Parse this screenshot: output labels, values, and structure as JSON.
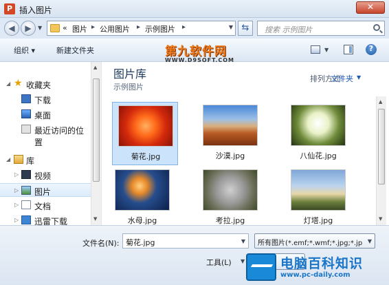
{
  "window": {
    "title": "插入图片",
    "app_icon_letter": "P",
    "close_label": "✕"
  },
  "address": {
    "overflow": "«",
    "crumbs": [
      "图片",
      "公用图片",
      "示例图片"
    ]
  },
  "search": {
    "placeholder": "搜索 示例图片"
  },
  "toolbar": {
    "organize": "组织 ▾",
    "new_folder": "新建文件夹"
  },
  "watermark_top": {
    "name": "第九软件网",
    "url": "WWW.D9SOFT.COM"
  },
  "sidebar": {
    "favorites": {
      "label": "收藏夹",
      "items": [
        "下载",
        "桌面",
        "最近访问的位置"
      ]
    },
    "libraries": {
      "label": "库",
      "items": [
        "视频",
        "图片",
        "文档",
        "迅雷下载"
      ]
    }
  },
  "content": {
    "title": "图片库",
    "subtitle": "示例图片",
    "arrange_label": "排列方式:",
    "arrange_value": "文件夹"
  },
  "files": [
    {
      "name": "菊花.jpg",
      "selected": true
    },
    {
      "name": "沙漠.jpg",
      "selected": false
    },
    {
      "name": "八仙花.jpg",
      "selected": false
    },
    {
      "name": "水母.jpg",
      "selected": false
    },
    {
      "name": "考拉.jpg",
      "selected": false
    },
    {
      "name": "灯塔.jpg",
      "selected": false
    }
  ],
  "footer": {
    "filename_label": "文件名(N):",
    "filename_value": "菊花.jpg",
    "filter_value": "所有图片(*.emf;*.wmf;*.jpg;*.jp",
    "tools_label": "工具(L)"
  },
  "watermark_bottom": {
    "name": "电脑百科知识",
    "url": "www.pc-daily.com"
  }
}
